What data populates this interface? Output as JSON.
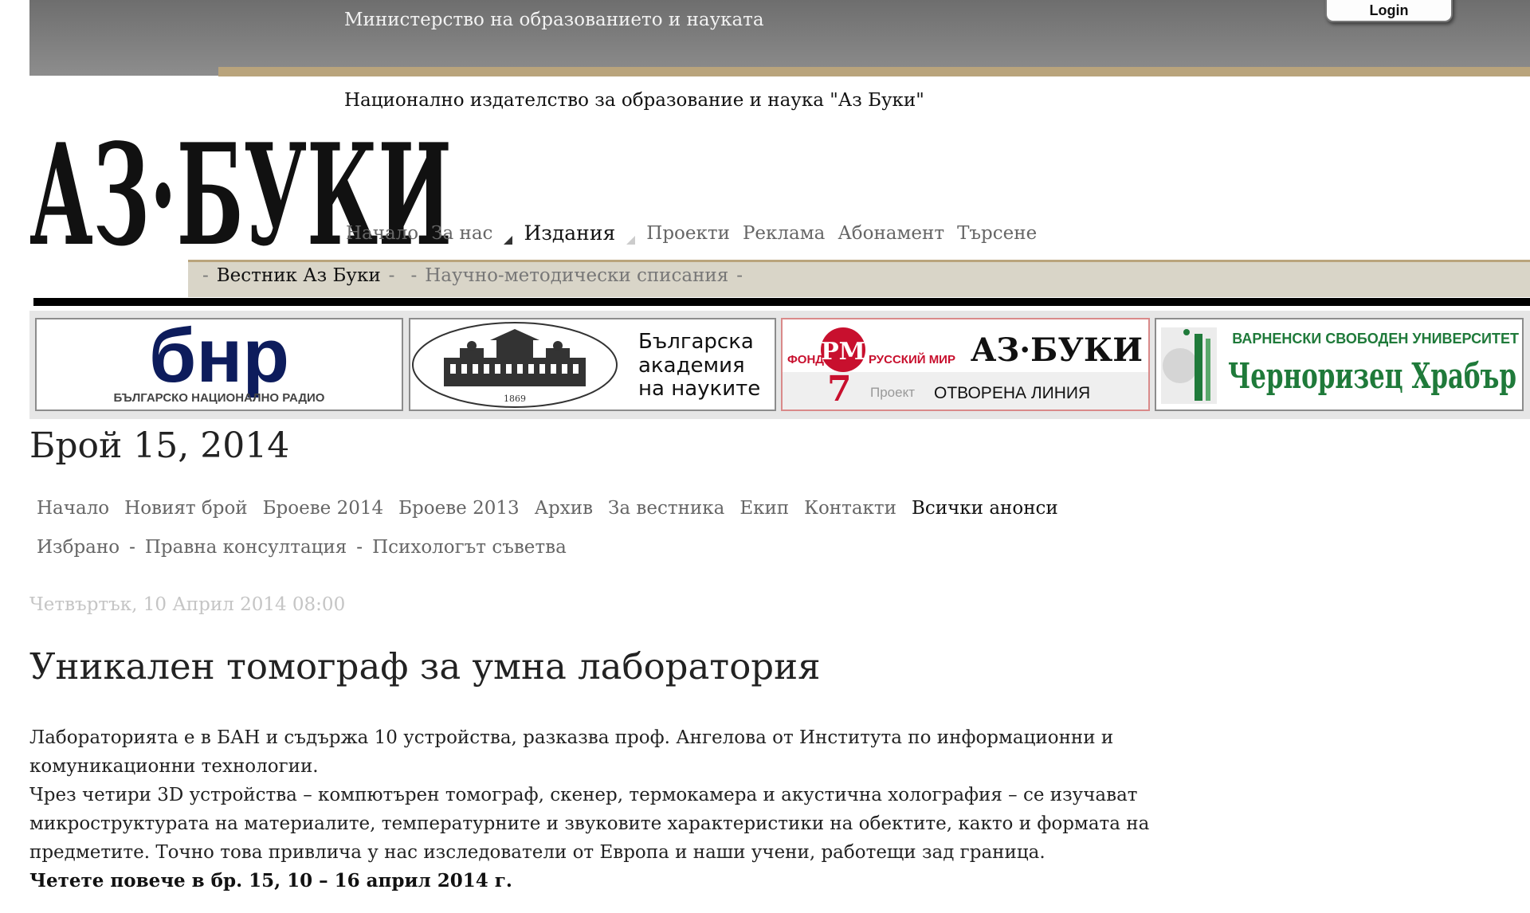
{
  "header": {
    "ministry": "Министерство на образованието и науката",
    "login_label": "Login",
    "publisher": "Национално издателство за образование и наука \"Аз Буки\"",
    "logo_text": "АЗ·БУКИ"
  },
  "main_nav": {
    "items": [
      "Начало",
      "За нас",
      "Издания",
      "Проекти",
      "Реклама",
      "Абонамент",
      "Търсене"
    ],
    "active": "Издания"
  },
  "sub_nav": {
    "items": [
      "Вестник Аз Буки",
      "Научно-методически списания"
    ]
  },
  "banners": {
    "bnr": {
      "logo": "бнр",
      "name": "БЪЛГАРСКО НАЦИОНАЛНО РАДИО"
    },
    "ban": {
      "line1": "Българска",
      "line2": "академия",
      "line3": "на науките",
      "year": "1869"
    },
    "russkiy_mir": {
      "fond": "ФОНД",
      "mark": "РМ",
      "name": "РУССКИЙ МИР",
      "brand": "АЗ·БУКИ",
      "project": "Проект",
      "line": "ОТВОРЕНА ЛИНИЯ"
    },
    "vsu": {
      "top": "ВАРНЕНСКИ СВОБОДЕН УНИВЕРСИТЕТ",
      "name": "Черноризец Храбър"
    },
    "colors": {
      "bnr_blue": "#0d1c5c",
      "russkiy_red": "#c8102e",
      "vsu_green": "#1f7a3a"
    }
  },
  "issue_title": "Брой 15, 2014",
  "section_nav": {
    "row1": [
      "Начало",
      "Новият брой",
      "Броеве 2014",
      "Броеве 2013",
      "Архив",
      "За вестника",
      "Екип",
      "Контакти",
      "Всички анонси"
    ],
    "row2": [
      "Избрано",
      "Правна консултация",
      "Психологът съветва"
    ]
  },
  "article": {
    "date": "Четвъртък, 10 Април 2014 08:00",
    "title": "Уникален томограф за умна лаборатория",
    "para1": "Лабораторията е в БАН и съдържа 10 устройства, разказва проф. Ангелова от Института по информационни и комуникационни технологии.",
    "para2": "Чрез четири 3D устройства – компютърен томограф, скенер, термокамера и акустична холография – се изучават микроструктурата на материалите, температурните и звуковите характеристики на обектите, както и формата на предметите. Точно това привлича у нас изследователи от Европа и наши учени, работещи зад граница.",
    "read_more": "Четете повече в бр. 15, 10 – 16 април 2014 г."
  }
}
